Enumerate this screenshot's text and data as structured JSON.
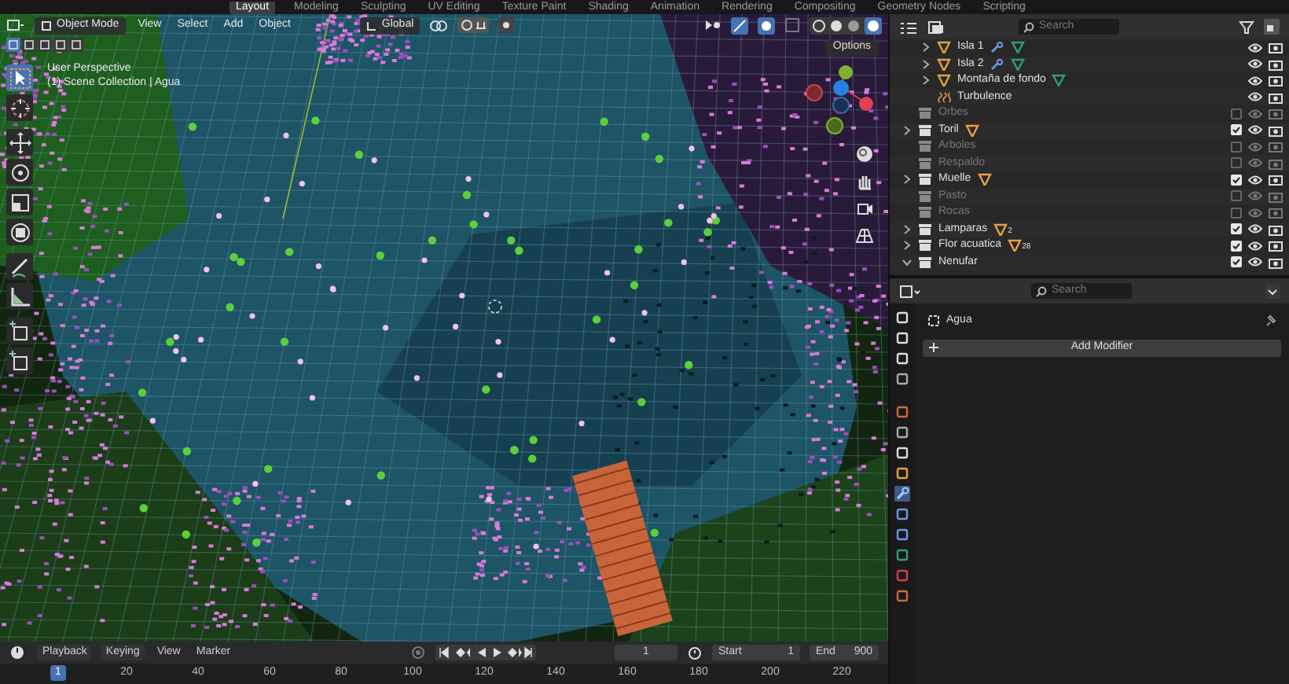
{
  "workspace_tabs": [
    {
      "label": "Layout",
      "selected": true
    },
    {
      "label": "Modeling",
      "selected": false
    },
    {
      "label": "Sculpting",
      "selected": false
    },
    {
      "label": "UV Editing",
      "selected": false
    },
    {
      "label": "Texture Paint",
      "selected": false
    },
    {
      "label": "Shading",
      "selected": false
    },
    {
      "label": "Animation",
      "selected": false
    },
    {
      "label": "Rendering",
      "selected": false
    },
    {
      "label": "Compositing",
      "selected": false
    },
    {
      "label": "Geometry Nodes",
      "selected": false
    },
    {
      "label": "Scripting",
      "selected": false
    }
  ],
  "viewport": {
    "mode": "Object Mode",
    "menus": [
      "View",
      "Select",
      "Add",
      "Object"
    ],
    "orientation": "Global",
    "options": "Options",
    "overlay_text": [
      "User Perspective",
      "(1) Scene Collection | Agua"
    ],
    "tools": [
      {
        "kind": "select",
        "selected": true
      },
      {
        "kind": "cursor",
        "selected": false
      },
      {
        "kind": "move",
        "selected": false
      },
      {
        "kind": "rotate",
        "selected": false
      },
      {
        "kind": "scale",
        "selected": false
      },
      {
        "kind": "transform",
        "selected": false
      },
      {
        "kind": "annotate",
        "selected": false
      },
      {
        "kind": "measure",
        "selected": false
      },
      {
        "kind": "add-cube",
        "selected": false
      },
      {
        "kind": "add-cube",
        "selected": false
      }
    ]
  },
  "outliner": {
    "search_placeholder": "Search",
    "rows": [
      {
        "kind": "object",
        "label": "Isla 1",
        "expanded": false
      },
      {
        "kind": "object",
        "label": "Isla 2",
        "expanded": false
      },
      {
        "kind": "object",
        "label": "Montaña de fondo",
        "expanded": false
      },
      {
        "kind": "force",
        "label": "Turbulence"
      },
      {
        "kind": "empty-collection",
        "label": "Orbes",
        "checked": false
      },
      {
        "kind": "collection",
        "label": "Toril",
        "expanded": false,
        "checked": true,
        "badge": ""
      },
      {
        "kind": "empty-collection",
        "label": "Arboles",
        "checked": false
      },
      {
        "kind": "empty-collection",
        "label": "Respaldo",
        "checked": false
      },
      {
        "kind": "collection",
        "label": "Muelle",
        "expanded": false,
        "checked": true,
        "badge": ""
      },
      {
        "kind": "empty-collection",
        "label": "Pasto",
        "checked": false
      },
      {
        "kind": "empty-collection",
        "label": "Rocas",
        "checked": false
      },
      {
        "kind": "collection",
        "label": "Lamparas",
        "expanded": false,
        "checked": true,
        "badge": "2"
      },
      {
        "kind": "collection",
        "label": "Flor acuatica",
        "expanded": false,
        "checked": true,
        "badge": "28"
      },
      {
        "kind": "collection",
        "label": "Nenufar",
        "expanded": true,
        "checked": true
      }
    ]
  },
  "properties": {
    "search_placeholder": "Search",
    "object_name": "Agua",
    "add_modifier": "Add Modifier"
  },
  "timeline": {
    "menus": [
      "Playback",
      "Keying",
      "View",
      "Marker"
    ],
    "current_frame": "1",
    "start_label": "Start",
    "start": "1",
    "end_label": "End",
    "end": "900",
    "ruler": [
      {
        "label": "1",
        "selected": true
      },
      {
        "label": "20",
        "selected": false
      },
      {
        "label": "40",
        "selected": false
      },
      {
        "label": "60",
        "selected": false
      },
      {
        "label": "80",
        "selected": false
      },
      {
        "label": "100",
        "selected": false
      },
      {
        "label": "120",
        "selected": false
      },
      {
        "label": "140",
        "selected": false
      },
      {
        "label": "160",
        "selected": false
      },
      {
        "label": "180",
        "selected": false
      },
      {
        "label": "200",
        "selected": false
      },
      {
        "label": "220",
        "selected": false
      }
    ]
  }
}
